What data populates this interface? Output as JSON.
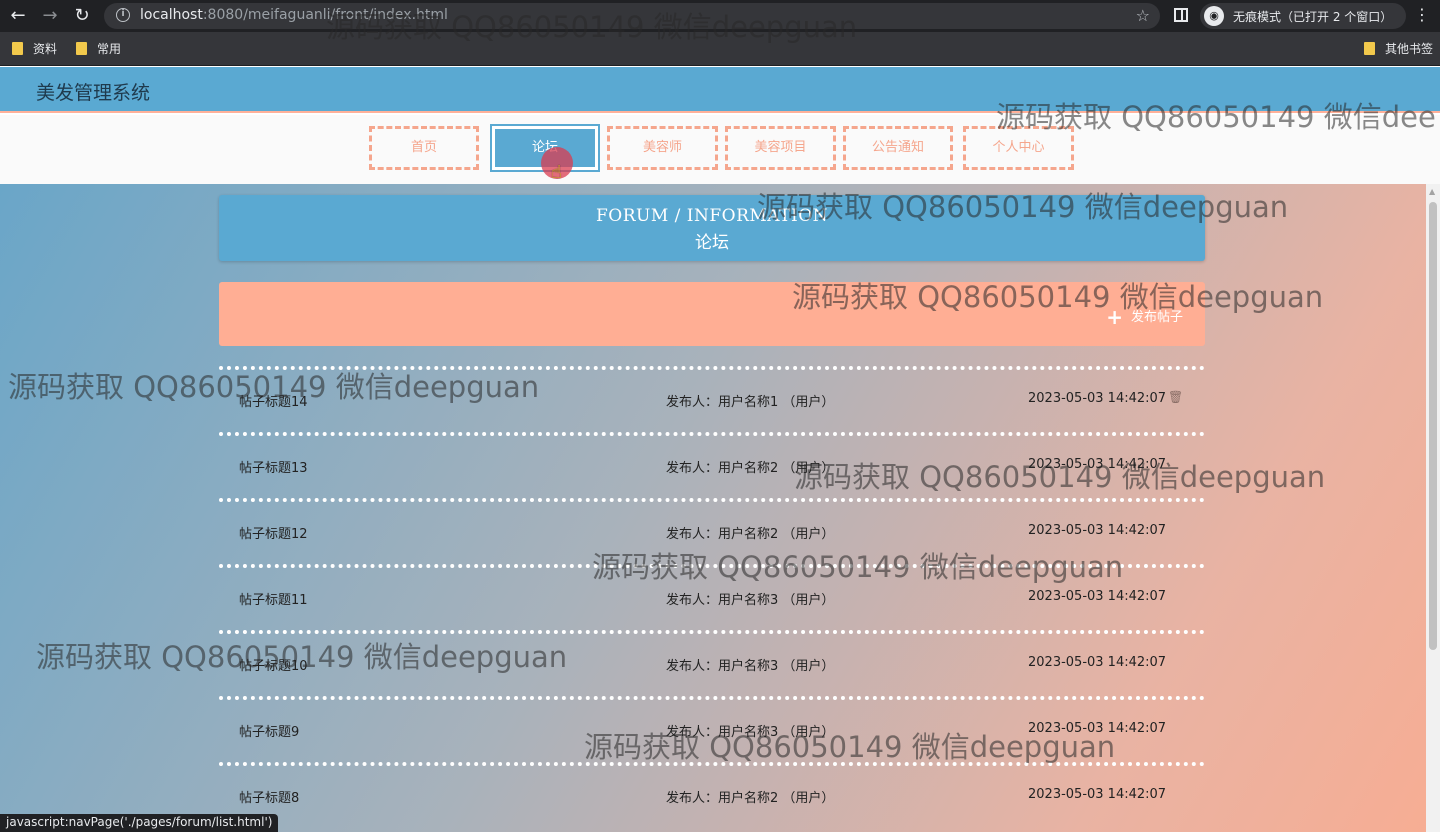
{
  "browser": {
    "url_host": "localhost",
    "url_rest": ":8080/meifaguanli/front/index.html",
    "incognito_text": "无痕模式（已打开 2 个窗口）",
    "bookmarks": [
      "资料",
      "常用",
      "其他书签"
    ]
  },
  "app": {
    "title": "美发管理系统",
    "nav": [
      "首页",
      "论坛",
      "美容师",
      "美容项目",
      "公告通知",
      "个人中心"
    ],
    "active_nav": "论坛"
  },
  "banner": {
    "en": "FORUM / INFORMATION",
    "cn": "论坛"
  },
  "publish": {
    "label": "发布帖子"
  },
  "posts": [
    {
      "title": "帖子标题14",
      "author": "发布人：用户名称1 （用户）",
      "time": "2023-05-03 14:42:07",
      "deletable": true
    },
    {
      "title": "帖子标题13",
      "author": "发布人：用户名称2 （用户）",
      "time": "2023-05-03 14:42:07"
    },
    {
      "title": "帖子标题12",
      "author": "发布人：用户名称2 （用户）",
      "time": "2023-05-03 14:42:07"
    },
    {
      "title": "帖子标题11",
      "author": "发布人：用户名称3 （用户）",
      "time": "2023-05-03 14:42:07"
    },
    {
      "title": "帖子标题10",
      "author": "发布人：用户名称3 （用户）",
      "time": "2023-05-03 14:42:07"
    },
    {
      "title": "帖子标题9",
      "author": "发布人：用户名称3 （用户）",
      "time": "2023-05-03 14:42:07"
    },
    {
      "title": "帖子标题8",
      "author": "发布人：用户名称2 （用户）",
      "time": "2023-05-03 14:42:07"
    }
  ],
  "status_tip": "javascript:navPage('./pages/forum/list.html')",
  "watermarks": [
    "源码获取 QQ86050149 微信deepguan",
    "源码获取 QQ86050149 微信dee",
    "源码获取 QQ86050149 微信deepguan",
    "源码获取 QQ86050149 微信deepguan",
    "源码获取 QQ86050149 微信deepguan",
    "源码获取 QQ86050149 微信deepguan",
    "源码获取 QQ86050149 微信deepguan",
    "源码获取 QQ86050149 微信deepguan",
    "源码获取 QQ86050149 微信deepguan"
  ]
}
